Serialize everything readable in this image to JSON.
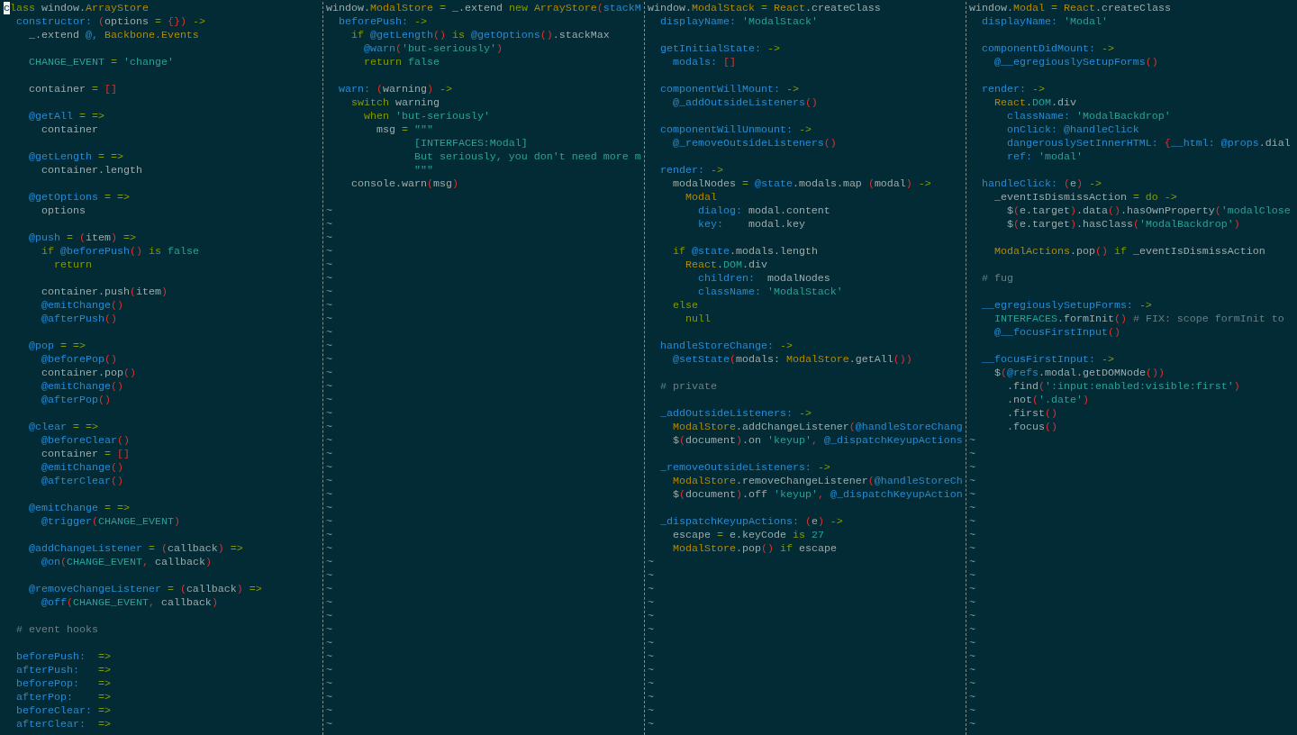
{
  "panes": [
    {
      "blocks": [
        [
          [
            {
              "kind": "cursor",
              "text": "c"
            },
            {
              "kind": "kw",
              "text": "lass"
            },
            {
              "kind": "plain",
              "text": " window."
            },
            {
              "kind": "type",
              "text": "ArrayStore"
            }
          ],
          [
            {
              "kind": "fn",
              "text": "  constructor: "
            },
            {
              "kind": "delim",
              "text": "("
            },
            {
              "kind": "plain",
              "text": "options "
            },
            {
              "kind": "kw",
              "text": "= "
            },
            {
              "kind": "delim",
              "text": "{})"
            },
            {
              "kind": "kw",
              "text": " ->"
            }
          ],
          [
            {
              "kind": "plain",
              "text": "    _.extend "
            },
            {
              "kind": "fn",
              "text": "@, "
            },
            {
              "kind": "type",
              "text": "Backbone.Events"
            }
          ]
        ],
        [
          [
            {
              "kind": "str",
              "text": "    CHANGE_EVENT "
            },
            {
              "kind": "kw",
              "text": "= "
            },
            {
              "kind": "str",
              "text": "'change'"
            }
          ]
        ],
        [
          [
            {
              "kind": "plain",
              "text": "    container "
            },
            {
              "kind": "kw",
              "text": "= "
            },
            {
              "kind": "delim",
              "text": "[]"
            }
          ]
        ],
        [
          [
            {
              "kind": "fn",
              "text": "    @getAll "
            },
            {
              "kind": "kw",
              "text": "= =>"
            }
          ],
          [
            {
              "kind": "plain",
              "text": "      container"
            }
          ]
        ],
        [
          [
            {
              "kind": "fn",
              "text": "    @getLength "
            },
            {
              "kind": "kw",
              "text": "= =>"
            }
          ],
          [
            {
              "kind": "plain",
              "text": "      container.length"
            }
          ]
        ],
        [
          [
            {
              "kind": "fn",
              "text": "    @getOptions "
            },
            {
              "kind": "kw",
              "text": "= =>"
            }
          ],
          [
            {
              "kind": "plain",
              "text": "      options"
            }
          ]
        ],
        [
          [
            {
              "kind": "fn",
              "text": "    @push "
            },
            {
              "kind": "kw",
              "text": "= "
            },
            {
              "kind": "delim",
              "text": "("
            },
            {
              "kind": "plain",
              "text": "item"
            },
            {
              "kind": "delim",
              "text": ")"
            },
            {
              "kind": "kw",
              "text": " =>"
            }
          ],
          [
            {
              "kind": "kw",
              "text": "      if "
            },
            {
              "kind": "fn",
              "text": "@beforePush"
            },
            {
              "kind": "delim",
              "text": "()"
            },
            {
              "kind": "kw",
              "text": " is "
            },
            {
              "kind": "str",
              "text": "false"
            }
          ],
          [
            {
              "kind": "kw",
              "text": "        return"
            }
          ]
        ],
        [
          [
            {
              "kind": "plain",
              "text": "      container.push"
            },
            {
              "kind": "delim",
              "text": "("
            },
            {
              "kind": "plain",
              "text": "item"
            },
            {
              "kind": "delim",
              "text": ")"
            }
          ],
          [
            {
              "kind": "fn",
              "text": "      @emitChange"
            },
            {
              "kind": "delim",
              "text": "()"
            }
          ],
          [
            {
              "kind": "fn",
              "text": "      @afterPush"
            },
            {
              "kind": "delim",
              "text": "()"
            }
          ]
        ],
        [
          [
            {
              "kind": "fn",
              "text": "    @pop "
            },
            {
              "kind": "kw",
              "text": "= =>"
            }
          ],
          [
            {
              "kind": "fn",
              "text": "      @beforePop"
            },
            {
              "kind": "delim",
              "text": "()"
            }
          ],
          [
            {
              "kind": "plain",
              "text": "      container.pop"
            },
            {
              "kind": "delim",
              "text": "()"
            }
          ],
          [
            {
              "kind": "fn",
              "text": "      @emitChange"
            },
            {
              "kind": "delim",
              "text": "()"
            }
          ],
          [
            {
              "kind": "fn",
              "text": "      @afterPop"
            },
            {
              "kind": "delim",
              "text": "()"
            }
          ]
        ],
        [
          [
            {
              "kind": "fn",
              "text": "    @clear "
            },
            {
              "kind": "kw",
              "text": "= =>"
            }
          ],
          [
            {
              "kind": "fn",
              "text": "      @beforeClear"
            },
            {
              "kind": "delim",
              "text": "()"
            }
          ],
          [
            {
              "kind": "plain",
              "text": "      container "
            },
            {
              "kind": "kw",
              "text": "= "
            },
            {
              "kind": "delim",
              "text": "[]"
            }
          ],
          [
            {
              "kind": "fn",
              "text": "      @emitChange"
            },
            {
              "kind": "delim",
              "text": "()"
            }
          ],
          [
            {
              "kind": "fn",
              "text": "      @afterClear"
            },
            {
              "kind": "delim",
              "text": "()"
            }
          ]
        ],
        [
          [
            {
              "kind": "fn",
              "text": "    @emitChange "
            },
            {
              "kind": "kw",
              "text": "= =>"
            }
          ],
          [
            {
              "kind": "fn",
              "text": "      @trigger"
            },
            {
              "kind": "delim",
              "text": "("
            },
            {
              "kind": "str",
              "text": "CHANGE_EVENT"
            },
            {
              "kind": "delim",
              "text": ")"
            }
          ]
        ],
        [
          [
            {
              "kind": "fn",
              "text": "    @addChangeListener "
            },
            {
              "kind": "kw",
              "text": "= "
            },
            {
              "kind": "delim",
              "text": "("
            },
            {
              "kind": "plain",
              "text": "callback"
            },
            {
              "kind": "delim",
              "text": ")"
            },
            {
              "kind": "kw",
              "text": " =>"
            }
          ],
          [
            {
              "kind": "fn",
              "text": "      @on"
            },
            {
              "kind": "delim",
              "text": "("
            },
            {
              "kind": "str",
              "text": "CHANGE_EVENT"
            },
            {
              "kind": "delim",
              "text": ", "
            },
            {
              "kind": "plain",
              "text": "callback"
            },
            {
              "kind": "delim",
              "text": ")"
            }
          ]
        ],
        [
          [
            {
              "kind": "fn",
              "text": "    @removeChangeListener "
            },
            {
              "kind": "kw",
              "text": "= "
            },
            {
              "kind": "delim",
              "text": "("
            },
            {
              "kind": "plain",
              "text": "callback"
            },
            {
              "kind": "delim",
              "text": ")"
            },
            {
              "kind": "kw",
              "text": " =>"
            }
          ],
          [
            {
              "kind": "fn",
              "text": "      @off"
            },
            {
              "kind": "delim",
              "text": "("
            },
            {
              "kind": "str",
              "text": "CHANGE_EVENT"
            },
            {
              "kind": "delim",
              "text": ", "
            },
            {
              "kind": "plain",
              "text": "callback"
            },
            {
              "kind": "delim",
              "text": ")"
            }
          ]
        ],
        [
          [
            {
              "kind": "comment",
              "text": "  # event hooks"
            }
          ]
        ],
        [
          [
            {
              "kind": "fn",
              "text": "  beforePush:  "
            },
            {
              "kind": "kw",
              "text": "=>"
            }
          ],
          [
            {
              "kind": "fn",
              "text": "  afterPush:   "
            },
            {
              "kind": "kw",
              "text": "=>"
            }
          ],
          [
            {
              "kind": "fn",
              "text": "  beforePop:   "
            },
            {
              "kind": "kw",
              "text": "=>"
            }
          ],
          [
            {
              "kind": "fn",
              "text": "  afterPop:    "
            },
            {
              "kind": "kw",
              "text": "=>"
            }
          ],
          [
            {
              "kind": "fn",
              "text": "  beforeClear: "
            },
            {
              "kind": "kw",
              "text": "=>"
            }
          ],
          [
            {
              "kind": "fn",
              "text": "  afterClear:  "
            },
            {
              "kind": "kw",
              "text": "=>"
            }
          ]
        ]
      ]
    },
    {
      "blocks": [
        [
          [
            {
              "kind": "plain",
              "text": "window."
            },
            {
              "kind": "type",
              "text": "ModalStore"
            },
            {
              "kind": "kw",
              "text": " = "
            },
            {
              "kind": "plain",
              "text": "_.extend "
            },
            {
              "kind": "kw",
              "text": "new "
            },
            {
              "kind": "type",
              "text": "ArrayStore"
            },
            {
              "kind": "delim",
              "text": "("
            },
            {
              "kind": "fn",
              "text": "stackM"
            }
          ],
          [
            {
              "kind": "fn",
              "text": "  beforePush: "
            },
            {
              "kind": "kw",
              "text": "->"
            }
          ],
          [
            {
              "kind": "kw",
              "text": "    if "
            },
            {
              "kind": "fn",
              "text": "@getLength"
            },
            {
              "kind": "delim",
              "text": "()"
            },
            {
              "kind": "kw",
              "text": " is "
            },
            {
              "kind": "fn",
              "text": "@getOptions"
            },
            {
              "kind": "delim",
              "text": "()"
            },
            {
              "kind": "plain",
              "text": ".stackMax"
            }
          ],
          [
            {
              "kind": "fn",
              "text": "      @warn"
            },
            {
              "kind": "delim",
              "text": "("
            },
            {
              "kind": "str",
              "text": "'but-seriously'"
            },
            {
              "kind": "delim",
              "text": ")"
            }
          ],
          [
            {
              "kind": "kw",
              "text": "      return "
            },
            {
              "kind": "str",
              "text": "false"
            }
          ]
        ],
        [
          [
            {
              "kind": "fn",
              "text": "  warn: "
            },
            {
              "kind": "delim",
              "text": "("
            },
            {
              "kind": "plain",
              "text": "warning"
            },
            {
              "kind": "delim",
              "text": ")"
            },
            {
              "kind": "kw",
              "text": " ->"
            }
          ],
          [
            {
              "kind": "kw",
              "text": "    switch "
            },
            {
              "kind": "plain",
              "text": "warning"
            }
          ],
          [
            {
              "kind": "kw",
              "text": "      when "
            },
            {
              "kind": "str",
              "text": "'but-seriously'"
            }
          ],
          [
            {
              "kind": "plain",
              "text": "        msg "
            },
            {
              "kind": "kw",
              "text": "= "
            },
            {
              "kind": "str",
              "text": "\"\"\""
            }
          ],
          [
            {
              "kind": "str",
              "text": "              [INTERFACES:Modal]"
            }
          ],
          [
            {
              "kind": "str",
              "text": "              But seriously, you don't need more m"
            }
          ],
          [
            {
              "kind": "str",
              "text": "              \"\"\""
            }
          ],
          [
            {
              "kind": "plain",
              "text": "    console.warn"
            },
            {
              "kind": "delim",
              "text": "("
            },
            {
              "kind": "plain",
              "text": "msg"
            },
            {
              "kind": "delim",
              "text": ")"
            }
          ]
        ]
      ],
      "filler_after_blank": [
        "~",
        "~",
        "~",
        "~",
        "~",
        "~",
        "~",
        "~",
        "~",
        "~",
        "~",
        "~",
        "~",
        "~",
        "~",
        "~",
        "~",
        "~",
        "~",
        "~",
        "~",
        "~",
        "~",
        "~",
        "~",
        "~",
        "~",
        "~",
        "~",
        "~",
        "~",
        "~",
        "~",
        "~",
        "~",
        "~",
        "~",
        "~",
        "~"
      ]
    },
    {
      "blocks": [
        [
          [
            {
              "kind": "plain",
              "text": "window."
            },
            {
              "kind": "type",
              "text": "ModalStack"
            },
            {
              "kind": "kw",
              "text": " = "
            },
            {
              "kind": "type",
              "text": "React"
            },
            {
              "kind": "plain",
              "text": ".createClass"
            }
          ],
          [
            {
              "kind": "fn",
              "text": "  displayName: "
            },
            {
              "kind": "str",
              "text": "'ModalStack'"
            }
          ]
        ],
        [
          [
            {
              "kind": "fn",
              "text": "  getInitialState: "
            },
            {
              "kind": "kw",
              "text": "->"
            }
          ],
          [
            {
              "kind": "fn",
              "text": "    modals: "
            },
            {
              "kind": "delim",
              "text": "[]"
            }
          ]
        ],
        [
          [
            {
              "kind": "fn",
              "text": "  componentWillMount: "
            },
            {
              "kind": "kw",
              "text": "->"
            }
          ],
          [
            {
              "kind": "fn",
              "text": "    @_addOutsideListeners"
            },
            {
              "kind": "delim",
              "text": "()"
            }
          ]
        ],
        [
          [
            {
              "kind": "fn",
              "text": "  componentWillUnmount: "
            },
            {
              "kind": "kw",
              "text": "->"
            }
          ],
          [
            {
              "kind": "fn",
              "text": "    @_removeOutsideListeners"
            },
            {
              "kind": "delim",
              "text": "()"
            }
          ]
        ],
        [
          [
            {
              "kind": "fn",
              "text": "  render: "
            },
            {
              "kind": "kw",
              "text": "->"
            }
          ],
          [
            {
              "kind": "plain",
              "text": "    modalNodes "
            },
            {
              "kind": "kw",
              "text": "= "
            },
            {
              "kind": "fn",
              "text": "@state"
            },
            {
              "kind": "plain",
              "text": ".modals.map "
            },
            {
              "kind": "delim",
              "text": "("
            },
            {
              "kind": "plain",
              "text": "modal"
            },
            {
              "kind": "delim",
              "text": ")"
            },
            {
              "kind": "kw",
              "text": " ->"
            }
          ],
          [
            {
              "kind": "type",
              "text": "      Modal"
            }
          ],
          [
            {
              "kind": "fn",
              "text": "        dialog: "
            },
            {
              "kind": "plain",
              "text": "modal.content"
            }
          ],
          [
            {
              "kind": "fn",
              "text": "        key:    "
            },
            {
              "kind": "plain",
              "text": "modal.key"
            }
          ]
        ],
        [
          [
            {
              "kind": "kw",
              "text": "    if "
            },
            {
              "kind": "fn",
              "text": "@state"
            },
            {
              "kind": "plain",
              "text": ".modals.length"
            }
          ],
          [
            {
              "kind": "type",
              "text": "      React"
            },
            {
              "kind": "plain",
              "text": "."
            },
            {
              "kind": "str",
              "text": "DOM"
            },
            {
              "kind": "plain",
              "text": ".div"
            }
          ],
          [
            {
              "kind": "fn",
              "text": "        children:  "
            },
            {
              "kind": "plain",
              "text": "modalNodes"
            }
          ],
          [
            {
              "kind": "fn",
              "text": "        className: "
            },
            {
              "kind": "str",
              "text": "'ModalStack'"
            }
          ],
          [
            {
              "kind": "kw",
              "text": "    else"
            }
          ],
          [
            {
              "kind": "kw",
              "text": "      null"
            }
          ]
        ],
        [
          [
            {
              "kind": "fn",
              "text": "  handleStoreChange: "
            },
            {
              "kind": "kw",
              "text": "->"
            }
          ],
          [
            {
              "kind": "fn",
              "text": "    @setState"
            },
            {
              "kind": "delim",
              "text": "("
            },
            {
              "kind": "plain",
              "text": "modals: "
            },
            {
              "kind": "type",
              "text": "ModalStore"
            },
            {
              "kind": "plain",
              "text": ".getAll"
            },
            {
              "kind": "delim",
              "text": "())"
            }
          ]
        ],
        [
          [
            {
              "kind": "comment",
              "text": "  # private"
            }
          ]
        ],
        [
          [
            {
              "kind": "fn",
              "text": "  _addOutsideListeners: "
            },
            {
              "kind": "kw",
              "text": "->"
            }
          ],
          [
            {
              "kind": "type",
              "text": "    ModalStore"
            },
            {
              "kind": "plain",
              "text": ".addChangeListener"
            },
            {
              "kind": "delim",
              "text": "("
            },
            {
              "kind": "fn",
              "text": "@handleStoreChang"
            }
          ],
          [
            {
              "kind": "plain",
              "text": "    $"
            },
            {
              "kind": "delim",
              "text": "("
            },
            {
              "kind": "plain",
              "text": "document"
            },
            {
              "kind": "delim",
              "text": ")"
            },
            {
              "kind": "plain",
              "text": ".on "
            },
            {
              "kind": "str",
              "text": "'keyup'"
            },
            {
              "kind": "delim",
              "text": ", "
            },
            {
              "kind": "fn",
              "text": "@_dispatchKeyupActions"
            }
          ]
        ],
        [
          [
            {
              "kind": "fn",
              "text": "  _removeOutsideListeners: "
            },
            {
              "kind": "kw",
              "text": "->"
            }
          ],
          [
            {
              "kind": "type",
              "text": "    ModalStore"
            },
            {
              "kind": "plain",
              "text": ".removeChangeListener"
            },
            {
              "kind": "delim",
              "text": "("
            },
            {
              "kind": "fn",
              "text": "@handleStoreCh"
            }
          ],
          [
            {
              "kind": "plain",
              "text": "    $"
            },
            {
              "kind": "delim",
              "text": "("
            },
            {
              "kind": "plain",
              "text": "document"
            },
            {
              "kind": "delim",
              "text": ")"
            },
            {
              "kind": "plain",
              "text": ".off "
            },
            {
              "kind": "str",
              "text": "'keyup'"
            },
            {
              "kind": "delim",
              "text": ", "
            },
            {
              "kind": "fn",
              "text": "@_dispatchKeyupAction"
            }
          ]
        ],
        [
          [
            {
              "kind": "fn",
              "text": "  _dispatchKeyupActions: "
            },
            {
              "kind": "delim",
              "text": "("
            },
            {
              "kind": "plain",
              "text": "e"
            },
            {
              "kind": "delim",
              "text": ")"
            },
            {
              "kind": "kw",
              "text": " ->"
            }
          ],
          [
            {
              "kind": "plain",
              "text": "    escape "
            },
            {
              "kind": "kw",
              "text": "= "
            },
            {
              "kind": "plain",
              "text": "e.keyCode "
            },
            {
              "kind": "kw",
              "text": "is "
            },
            {
              "kind": "str",
              "text": "27"
            }
          ],
          [
            {
              "kind": "type",
              "text": "    ModalStore"
            },
            {
              "kind": "plain",
              "text": ".pop"
            },
            {
              "kind": "delim",
              "text": "()"
            },
            {
              "kind": "kw",
              "text": " if "
            },
            {
              "kind": "plain",
              "text": "escape"
            }
          ]
        ]
      ],
      "filler": [
        "~",
        "~",
        "~",
        "~",
        "~",
        "~",
        "~",
        "~",
        "~",
        "~",
        "~",
        "~",
        "~"
      ]
    },
    {
      "blocks": [
        [
          [
            {
              "kind": "plain",
              "text": "window."
            },
            {
              "kind": "type",
              "text": "Modal"
            },
            {
              "kind": "kw",
              "text": " = "
            },
            {
              "kind": "type",
              "text": "React"
            },
            {
              "kind": "plain",
              "text": ".createClass"
            }
          ],
          [
            {
              "kind": "fn",
              "text": "  displayName: "
            },
            {
              "kind": "str",
              "text": "'Modal'"
            }
          ]
        ],
        [
          [
            {
              "kind": "fn",
              "text": "  componentDidMount: "
            },
            {
              "kind": "kw",
              "text": "->"
            }
          ],
          [
            {
              "kind": "fn",
              "text": "    @__egregiouslySetupForms"
            },
            {
              "kind": "delim",
              "text": "()"
            }
          ]
        ],
        [
          [
            {
              "kind": "fn",
              "text": "  render: "
            },
            {
              "kind": "kw",
              "text": "->"
            }
          ],
          [
            {
              "kind": "type",
              "text": "    React"
            },
            {
              "kind": "plain",
              "text": "."
            },
            {
              "kind": "str",
              "text": "DOM"
            },
            {
              "kind": "plain",
              "text": ".div"
            }
          ],
          [
            {
              "kind": "fn",
              "text": "      className: "
            },
            {
              "kind": "str",
              "text": "'ModalBackdrop'"
            }
          ],
          [
            {
              "kind": "fn",
              "text": "      onClick: @handleClick"
            }
          ],
          [
            {
              "kind": "fn",
              "text": "      dangerouslySetInnerHTML: "
            },
            {
              "kind": "delim",
              "text": "{"
            },
            {
              "kind": "fn",
              "text": "__html: @props"
            },
            {
              "kind": "plain",
              "text": ".dial"
            }
          ],
          [
            {
              "kind": "fn",
              "text": "      ref: "
            },
            {
              "kind": "str",
              "text": "'modal'"
            }
          ]
        ],
        [
          [
            {
              "kind": "fn",
              "text": "  handleClick: "
            },
            {
              "kind": "delim",
              "text": "("
            },
            {
              "kind": "plain",
              "text": "e"
            },
            {
              "kind": "delim",
              "text": ")"
            },
            {
              "kind": "kw",
              "text": " ->"
            }
          ],
          [
            {
              "kind": "plain",
              "text": "    _eventIsDismissAction "
            },
            {
              "kind": "kw",
              "text": "= do ->"
            }
          ],
          [
            {
              "kind": "plain",
              "text": "      $"
            },
            {
              "kind": "delim",
              "text": "("
            },
            {
              "kind": "plain",
              "text": "e.target"
            },
            {
              "kind": "delim",
              "text": ")"
            },
            {
              "kind": "plain",
              "text": ".data"
            },
            {
              "kind": "delim",
              "text": "()"
            },
            {
              "kind": "plain",
              "text": ".hasOwnProperty"
            },
            {
              "kind": "delim",
              "text": "("
            },
            {
              "kind": "str",
              "text": "'modalClose"
            }
          ],
          [
            {
              "kind": "plain",
              "text": "      $"
            },
            {
              "kind": "delim",
              "text": "("
            },
            {
              "kind": "plain",
              "text": "e.target"
            },
            {
              "kind": "delim",
              "text": ")"
            },
            {
              "kind": "plain",
              "text": ".hasClass"
            },
            {
              "kind": "delim",
              "text": "("
            },
            {
              "kind": "str",
              "text": "'ModalBackdrop'"
            },
            {
              "kind": "delim",
              "text": ")"
            }
          ]
        ],
        [
          [
            {
              "kind": "type",
              "text": "    ModalActions"
            },
            {
              "kind": "plain",
              "text": ".pop"
            },
            {
              "kind": "delim",
              "text": "()"
            },
            {
              "kind": "kw",
              "text": " if "
            },
            {
              "kind": "plain",
              "text": "_eventIsDismissAction"
            }
          ]
        ],
        [
          [
            {
              "kind": "comment",
              "text": "  # fug"
            }
          ]
        ],
        [
          [
            {
              "kind": "fn",
              "text": "  __egregiouslySetupForms: "
            },
            {
              "kind": "kw",
              "text": "->"
            }
          ],
          [
            {
              "kind": "str",
              "text": "    INTERFACES"
            },
            {
              "kind": "plain",
              "text": ".formInit"
            },
            {
              "kind": "delim",
              "text": "()"
            },
            {
              "kind": "comment",
              "text": " # FIX: scope formInit to"
            }
          ],
          [
            {
              "kind": "fn",
              "text": "    @__focusFirstInput"
            },
            {
              "kind": "delim",
              "text": "()"
            }
          ]
        ],
        [
          [
            {
              "kind": "fn",
              "text": "  __focusFirstInput: "
            },
            {
              "kind": "kw",
              "text": "->"
            }
          ],
          [
            {
              "kind": "plain",
              "text": "    $"
            },
            {
              "kind": "delim",
              "text": "("
            },
            {
              "kind": "fn",
              "text": "@refs"
            },
            {
              "kind": "plain",
              "text": ".modal.getDOMNode"
            },
            {
              "kind": "delim",
              "text": "())"
            }
          ],
          [
            {
              "kind": "plain",
              "text": "      .find"
            },
            {
              "kind": "delim",
              "text": "("
            },
            {
              "kind": "str",
              "text": "':input:enabled:visible:first'"
            },
            {
              "kind": "delim",
              "text": ")"
            }
          ],
          [
            {
              "kind": "plain",
              "text": "      .not"
            },
            {
              "kind": "delim",
              "text": "("
            },
            {
              "kind": "str",
              "text": "'.date'"
            },
            {
              "kind": "delim",
              "text": ")"
            }
          ],
          [
            {
              "kind": "plain",
              "text": "      .first"
            },
            {
              "kind": "delim",
              "text": "()"
            }
          ],
          [
            {
              "kind": "plain",
              "text": "      .focus"
            },
            {
              "kind": "delim",
              "text": "()"
            }
          ]
        ]
      ],
      "filler": [
        "~",
        "~",
        "~",
        "~",
        "~",
        "~",
        "~",
        "~",
        "~",
        "~",
        "~",
        "~",
        "~",
        "~",
        "~",
        "~",
        "~",
        "~",
        "~",
        "~",
        "~",
        "~"
      ]
    }
  ]
}
